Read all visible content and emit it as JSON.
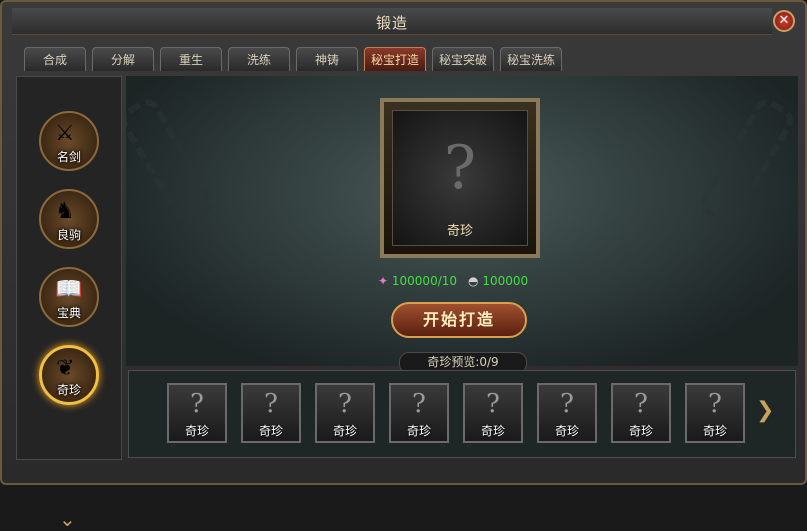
{
  "window": {
    "title": "锻造",
    "close_icon": "close-icon"
  },
  "tabs": [
    {
      "label": "合成",
      "active": false
    },
    {
      "label": "分解",
      "active": false
    },
    {
      "label": "重生",
      "active": false
    },
    {
      "label": "洗练",
      "active": false
    },
    {
      "label": "神铸",
      "active": false
    },
    {
      "label": "秘宝打造",
      "active": true
    },
    {
      "label": "秘宝突破",
      "active": false
    },
    {
      "label": "秘宝洗练",
      "active": false
    }
  ],
  "categories": [
    {
      "label": "名剑",
      "icon": "sword-icon",
      "active": false
    },
    {
      "label": "良驹",
      "icon": "horse-icon",
      "active": false
    },
    {
      "label": "宝典",
      "icon": "book-icon",
      "active": false
    },
    {
      "label": "奇珍",
      "icon": "feather-icon",
      "active": true
    }
  ],
  "main": {
    "frame_label": "奇珍",
    "cost_gem": "100000/10",
    "cost_silver": "100000",
    "forge_button": "开始打造",
    "preview_title": "奇珍预览:0/9"
  },
  "slots": [
    {
      "label": "奇珍"
    },
    {
      "label": "奇珍"
    },
    {
      "label": "奇珍"
    },
    {
      "label": "奇珍"
    },
    {
      "label": "奇珍"
    },
    {
      "label": "奇珍"
    },
    {
      "label": "奇珍"
    },
    {
      "label": "奇珍"
    }
  ]
}
